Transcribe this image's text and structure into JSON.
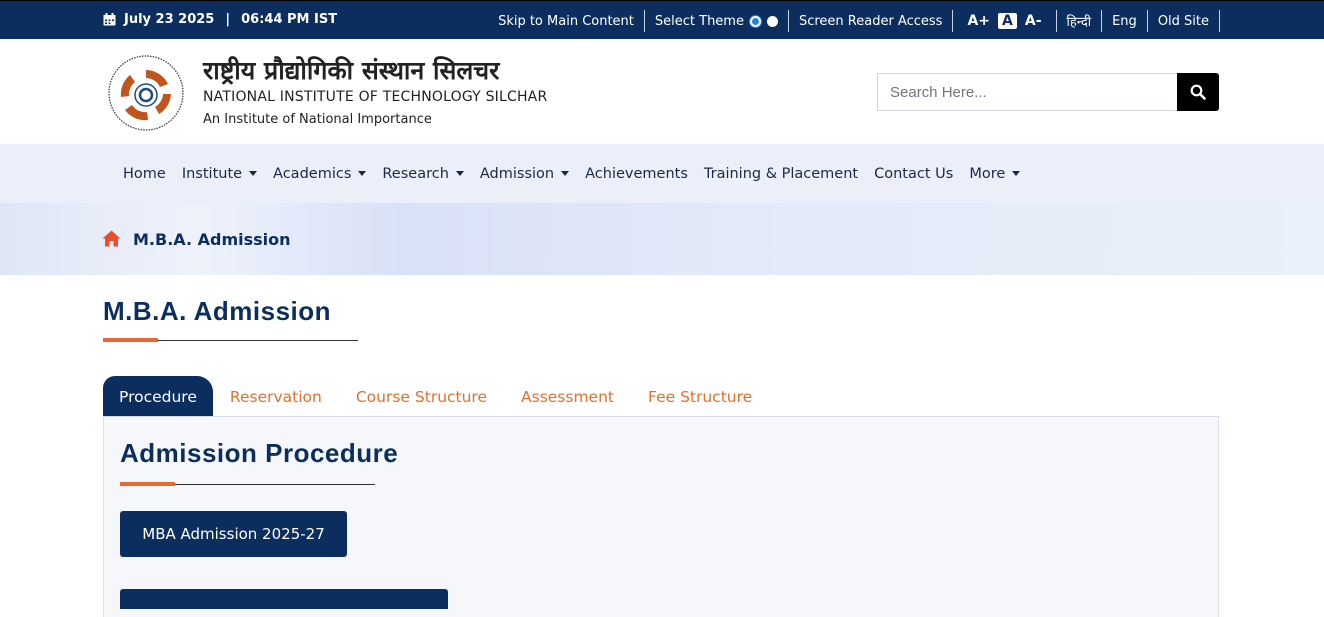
{
  "topbar": {
    "date": "July 23 2025",
    "separator": "|",
    "time": "06:44 PM IST",
    "skip": "Skip to Main Content",
    "select_theme": "Select Theme",
    "screen_reader": "Screen Reader Access",
    "font_increase": "A+",
    "font_normal": "A",
    "font_decrease": "A-",
    "hindi": "हिन्दी",
    "english": "Eng",
    "old_site": "Old Site"
  },
  "header": {
    "name_hindi": "राष्ट्रीय प्रौद्योगिकी संस्थान सिलचर",
    "name_english": "NATIONAL INSTITUTE OF TECHNOLOGY SILCHAR",
    "tagline": "An Institute of National Importance",
    "search_placeholder": "Search Here..."
  },
  "nav": {
    "items": [
      {
        "label": "Home",
        "dropdown": false
      },
      {
        "label": "Institute",
        "dropdown": true
      },
      {
        "label": "Academics",
        "dropdown": true
      },
      {
        "label": "Research",
        "dropdown": true
      },
      {
        "label": "Admission",
        "dropdown": true
      },
      {
        "label": "Achievements",
        "dropdown": false
      },
      {
        "label": "Training & Placement",
        "dropdown": false
      },
      {
        "label": "Contact Us",
        "dropdown": false
      },
      {
        "label": "More",
        "dropdown": true
      }
    ]
  },
  "breadcrumb": {
    "label": "M.B.A. Admission"
  },
  "page": {
    "title": "M.B.A. Admission",
    "tabs": [
      "Procedure",
      "Reservation",
      "Course Structure",
      "Assessment",
      "Fee Structure"
    ],
    "active_tab": "Procedure",
    "section_title": "Admission Procedure",
    "primary_button": "MBA Admission 2025-27"
  },
  "colors": {
    "navy": "#0b2e5e",
    "accent": "#e86a33",
    "nav_bg": "#eceefa"
  }
}
